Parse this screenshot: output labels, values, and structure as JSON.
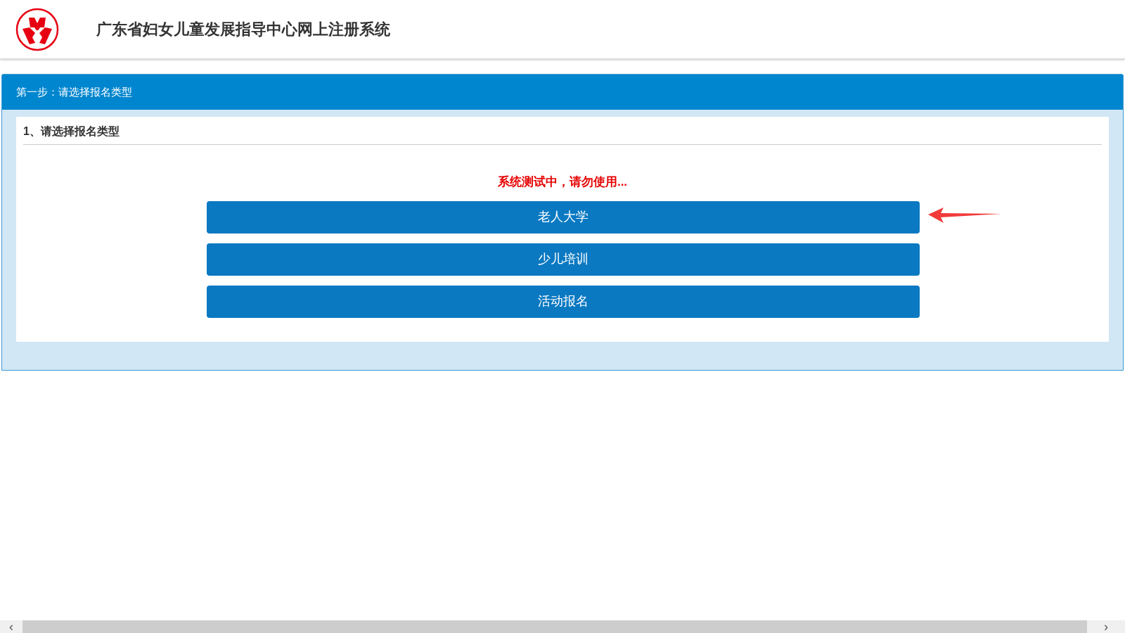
{
  "header": {
    "title": "广东省妇女儿童发展指导中心网上注册系统"
  },
  "panel": {
    "title": "第一步：请选择报名类型",
    "section_heading": "1、请选择报名类型",
    "notice": "系统测试中，请勿使用...",
    "options": [
      {
        "label": "老人大学",
        "pointed": true
      },
      {
        "label": "少儿培训",
        "pointed": false
      },
      {
        "label": "活动报名",
        "pointed": false
      }
    ]
  },
  "scrollbar": {
    "left": "‹",
    "right": "›"
  }
}
